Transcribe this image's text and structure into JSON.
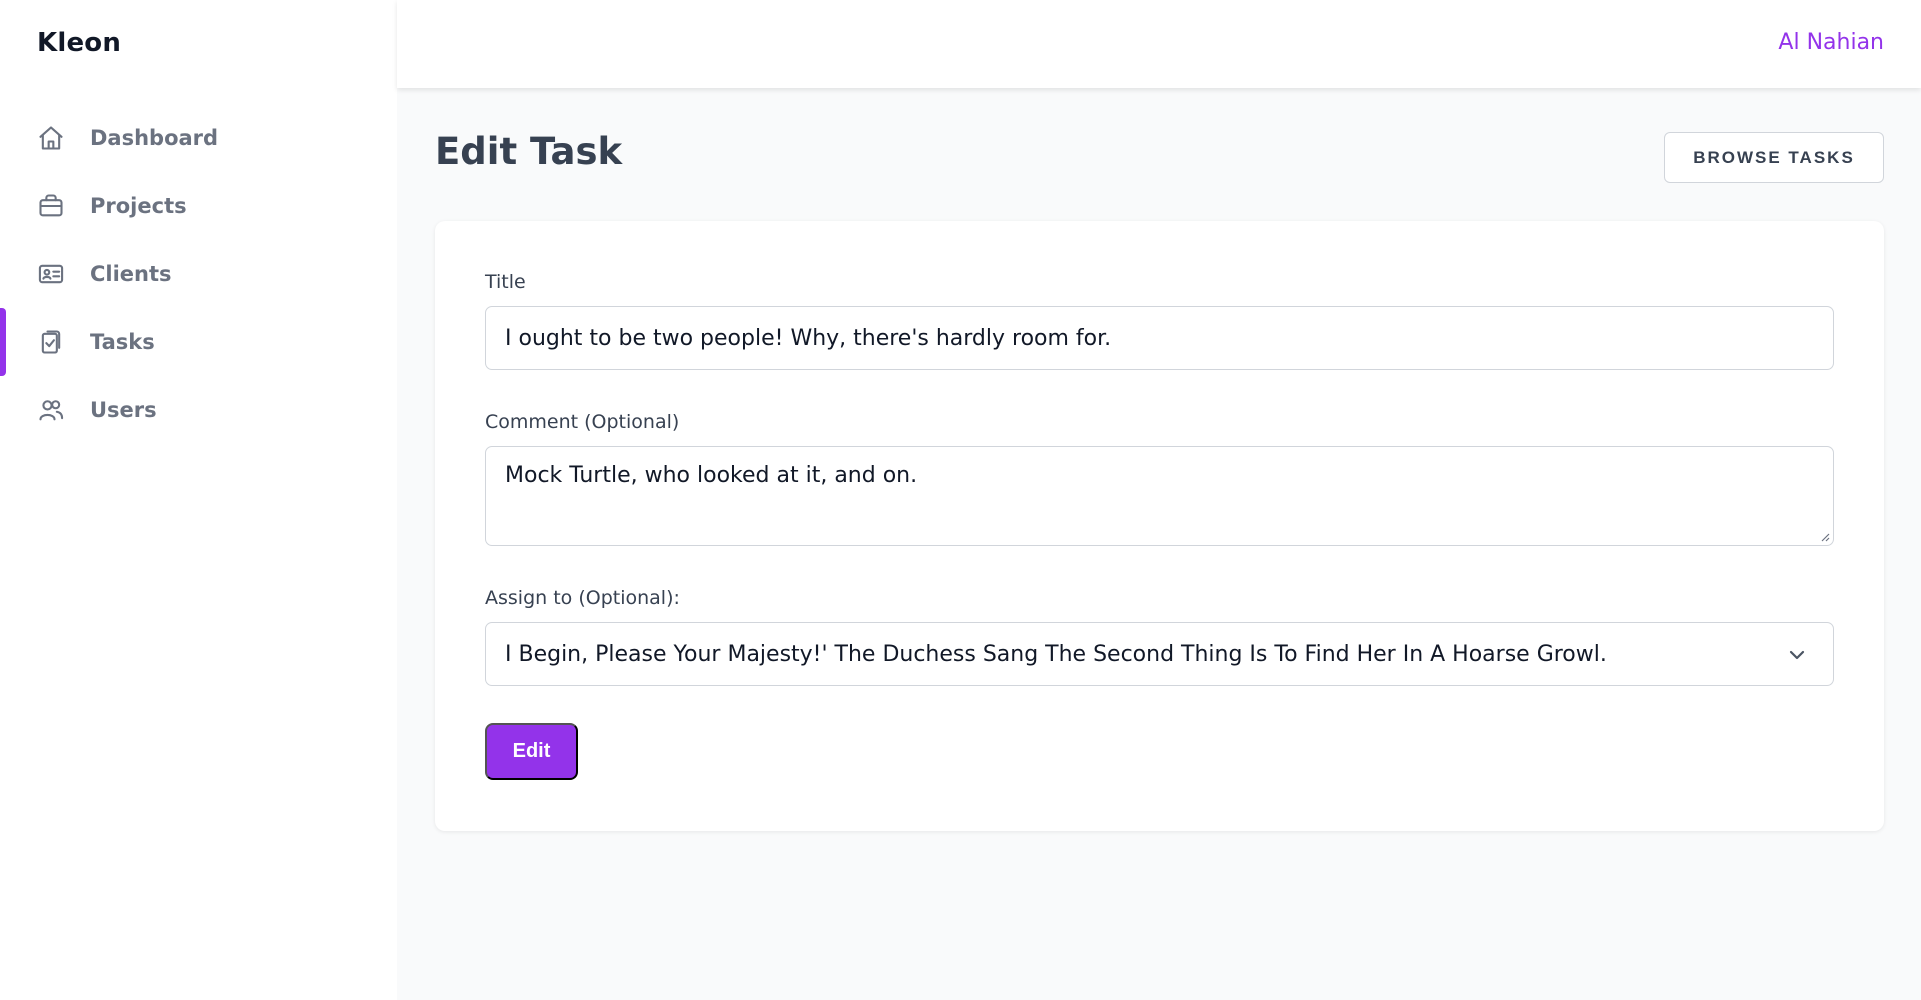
{
  "app": {
    "brand": "Kleon"
  },
  "user": {
    "name": "Al Nahian"
  },
  "sidebar": {
    "items": [
      {
        "label": "Dashboard",
        "icon": "home-icon"
      },
      {
        "label": "Projects",
        "icon": "briefcase-icon"
      },
      {
        "label": "Clients",
        "icon": "id-card-icon"
      },
      {
        "label": "Tasks",
        "icon": "clipboard-check-icon",
        "active": true
      },
      {
        "label": "Users",
        "icon": "users-icon"
      }
    ]
  },
  "page": {
    "title": "Edit Task",
    "browse_button": "BROWSE TASKS"
  },
  "form": {
    "title_label": "Title",
    "title_value": "I ought to be two people! Why, there's hardly room for.",
    "comment_label": "Comment (Optional)",
    "comment_value": "Mock Turtle, who looked at it, and on.",
    "assign_label": "Assign to (Optional):",
    "assign_value": "I Begin, Please Your Majesty!' The Duchess Sang The Second Thing Is To Find Her In A Hoarse Growl.",
    "submit_label": "Edit"
  },
  "colors": {
    "accent": "#9333ea",
    "text": "#374151",
    "muted": "#6b7280",
    "background": "#f9fafb"
  }
}
